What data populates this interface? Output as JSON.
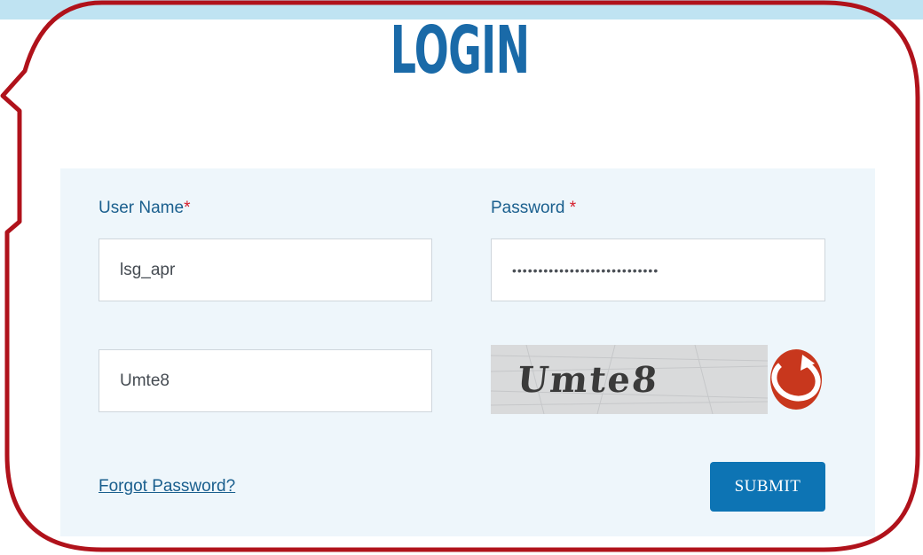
{
  "page": {
    "title": "LOGIN"
  },
  "form": {
    "username_label": "User Name",
    "password_label": "Password ",
    "required_mark": "*",
    "username_value": "lsg_apr",
    "password_value": "••••••••••••••••••••••••••••",
    "captcha_input_value": "Umte8",
    "captcha_image_text": "Umte8",
    "forgot_password_label": "Forgot Password?",
    "submit_label": "SUBMIT"
  },
  "icons": {
    "refresh": "refresh-captcha-icon"
  },
  "colors": {
    "title": "#1a6aa8",
    "label": "#1a5f8e",
    "required": "#d51c2a",
    "panel_bg": "#eef6fb",
    "submit_bg": "#0d74b4",
    "callout_border": "#b0121b",
    "refresh_icon": "#c8371d",
    "top_strip": "#bfe3f2"
  }
}
